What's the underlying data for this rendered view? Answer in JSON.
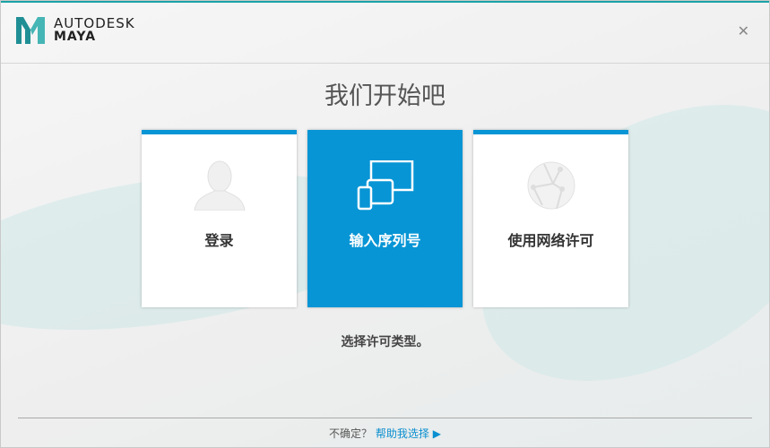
{
  "header": {
    "brand": "AUTODESK",
    "product": "MAYA",
    "close_icon": "close-icon"
  },
  "title": "我们开始吧",
  "cards": [
    {
      "label": "登录",
      "icon": "user-icon",
      "selected": false
    },
    {
      "label": "输入序列号",
      "icon": "devices-icon",
      "selected": true
    },
    {
      "label": "使用网络许可",
      "icon": "network-globe-icon",
      "selected": false
    }
  ],
  "hint": "选择许可类型。",
  "footer": {
    "question": "不确定？",
    "link": "帮助我选择"
  },
  "colors": {
    "accent": "#0795d5",
    "link": "#0a8fd0"
  }
}
